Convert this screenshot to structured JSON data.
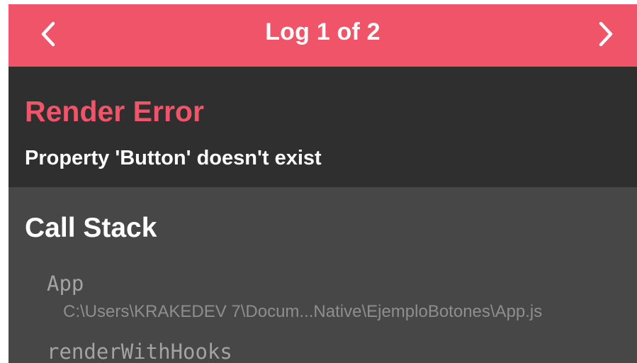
{
  "header": {
    "title": "Log 1 of 2",
    "prev_icon": "chevron-left-icon",
    "next_icon": "chevron-right-icon"
  },
  "error": {
    "title": "Render Error",
    "message": "Property 'Button' doesn't exist"
  },
  "call_stack": {
    "heading": "Call Stack",
    "frames": [
      {
        "name": "App",
        "path": "C:\\Users\\KRAKEDEV 7\\Docum...Native\\EjemploBotones\\App.js"
      },
      {
        "name": "renderWithHooks",
        "path": ""
      }
    ]
  },
  "colors": {
    "accent": "#ef5468",
    "error_bg": "#2f2f2f",
    "stack_bg": "#474747",
    "text_primary": "#ffffff",
    "text_muted": "#a3a3a3"
  }
}
